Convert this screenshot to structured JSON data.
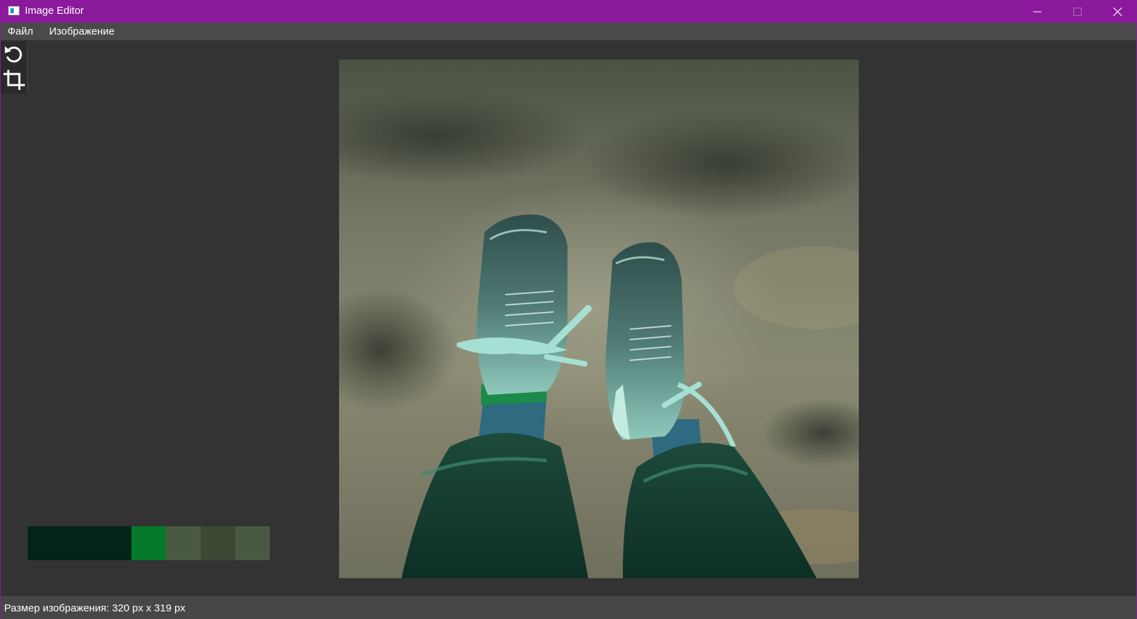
{
  "window": {
    "title": "Image Editor"
  },
  "menu": {
    "items": [
      "Файл",
      "Изображение"
    ]
  },
  "toolbar": {
    "tools": [
      {
        "icon": "undo-icon"
      },
      {
        "icon": "crop-icon"
      }
    ]
  },
  "palette": {
    "colors": [
      "#02241a",
      "#02241a",
      "#02241a",
      "#047a2a",
      "#4a5a42",
      "#3a4834",
      "#4a5a42"
    ]
  },
  "status": {
    "text": "Размер изображения: 320 px x 319 px"
  },
  "colors": {
    "titlebar": "#8a1a9b",
    "background": "#333333",
    "menubar": "#4a4a4a",
    "statusbar": "#474747"
  }
}
